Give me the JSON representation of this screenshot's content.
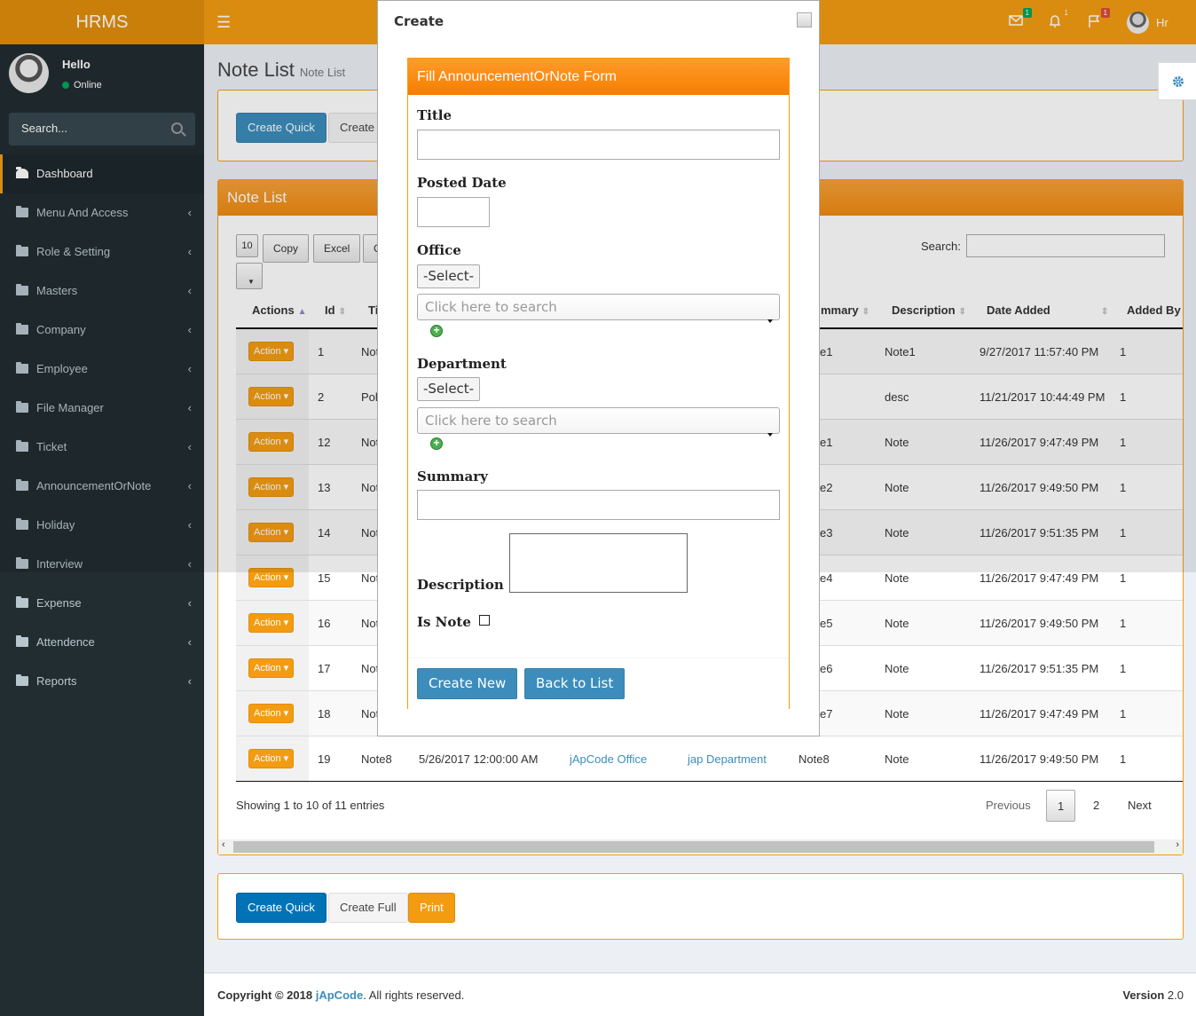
{
  "app": {
    "logo": "HRMS"
  },
  "topbar": {
    "mail_badge": "1",
    "bell_badge": "1",
    "flag_badge": "1",
    "user_name": "Hr",
    "colors": {
      "mail_badge": "#00a65a",
      "bell_badge": "#f39c12",
      "flag_badge": "#dd4b39"
    }
  },
  "sidebar": {
    "hello": "Hello",
    "status": "Online",
    "search_placeholder": "Search...",
    "items": [
      {
        "label": "Dashboard"
      },
      {
        "label": "Menu And Access"
      },
      {
        "label": "Role & Setting"
      },
      {
        "label": "Masters"
      },
      {
        "label": "Company"
      },
      {
        "label": "Employee"
      },
      {
        "label": "File Manager"
      },
      {
        "label": "Ticket"
      },
      {
        "label": "AnnouncementOrNote"
      },
      {
        "label": "Holiday"
      },
      {
        "label": "Interview"
      },
      {
        "label": "Expense"
      },
      {
        "label": "Attendence"
      },
      {
        "label": "Reports"
      }
    ]
  },
  "page": {
    "title": "Note List",
    "subtitle": "Note List"
  },
  "top_actions": {
    "create_quick": "Create Quick",
    "create_full_partial": "Create I"
  },
  "list_box": {
    "title": "Note List",
    "page_len": "10",
    "copy": "Copy",
    "excel": "Excel",
    "csv_partial": "C",
    "search_label": "Search:",
    "columns": {
      "actions": "Actions",
      "id": "Id",
      "title_partial": "Ti",
      "summary_partial": "mmary",
      "description": "Description",
      "date_added": "Date Added",
      "added_by": "Added By"
    },
    "action_label": "Action",
    "rows": [
      {
        "id": "1",
        "title": "Not",
        "summary": "e1",
        "description": "Note1",
        "date": "9/27/2017 11:57:40 PM",
        "by": "1"
      },
      {
        "id": "2",
        "title": "Pol",
        "summary": "",
        "description": "desc",
        "date": "11/21/2017 10:44:49 PM",
        "by": "1"
      },
      {
        "id": "12",
        "title": "Not",
        "summary": "e1",
        "description": "Note",
        "date": "11/26/2017 9:47:49 PM",
        "by": "1"
      },
      {
        "id": "13",
        "title": "Not",
        "summary": "e2",
        "description": "Note",
        "date": "11/26/2017 9:49:50 PM",
        "by": "1"
      },
      {
        "id": "14",
        "title": "Not",
        "summary": "e3",
        "description": "Note",
        "date": "11/26/2017 9:51:35 PM",
        "by": "1"
      },
      {
        "id": "15",
        "title": "Not",
        "summary": "e4",
        "description": "Note",
        "date": "11/26/2017 9:47:49 PM",
        "by": "1"
      },
      {
        "id": "16",
        "title": "Not",
        "summary": "e5",
        "description": "Note",
        "date": "11/26/2017 9:49:50 PM",
        "by": "1"
      },
      {
        "id": "17",
        "title": "Not",
        "summary": "e6",
        "description": "Note",
        "date": "11/26/2017 9:51:35 PM",
        "by": "1"
      },
      {
        "id": "18",
        "title": "Not",
        "summary": "e7",
        "description": "Note",
        "date": "11/26/2017 9:47:49 PM",
        "by": "1"
      }
    ],
    "last_row": {
      "id": "19",
      "title": "Note8",
      "posted": "5/26/2017 12:00:00 AM",
      "office": "jApCode Office",
      "department": "jap Department",
      "summary": "Note8",
      "description": "Note",
      "date": "11/26/2017 9:49:50 PM",
      "by": "1"
    },
    "showing": "Showing 1 to 10 of 11 entries",
    "pagination": {
      "previous": "Previous",
      "page1": "1",
      "page2": "2",
      "next": "Next"
    }
  },
  "bottom_actions": {
    "create_quick": "Create Quick",
    "create_full": "Create Full",
    "print": "Print"
  },
  "footer": {
    "copyright": "Copyright © 2018",
    "brand": "jApCode",
    "rights": ". All rights reserved.",
    "version_label": "Version",
    "version": "2.0"
  },
  "modal": {
    "title": "Create",
    "form_title": "Fill AnnouncementOrNote Form",
    "labels": {
      "title": "Title",
      "posted_date": "Posted Date",
      "office": "Office",
      "department": "Department",
      "summary": "Summary",
      "description": "Description",
      "is_note": "Is Note"
    },
    "select_label": "-Select-",
    "search_placeholder": "Click here to search",
    "create_new": "Create New",
    "back_to_list": "Back to List"
  }
}
